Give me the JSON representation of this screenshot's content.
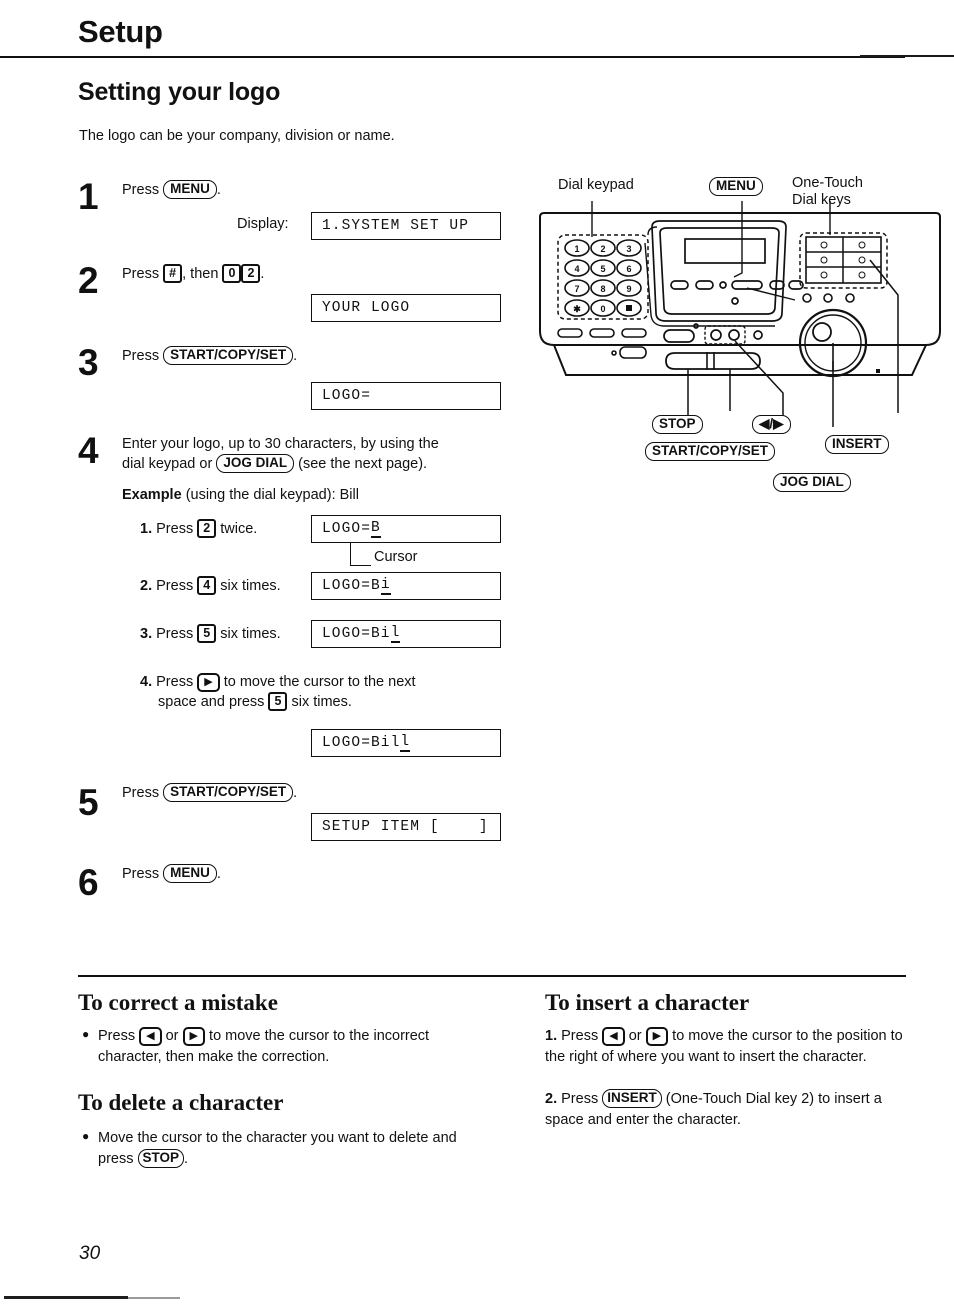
{
  "page": {
    "chapter": "Setup",
    "section_title": "Setting your logo",
    "intro": "The logo can be your company, division or name.",
    "page_number": "30"
  },
  "steps": [
    {
      "num": "1",
      "text_before": "Press",
      "key": "MENU",
      "text_after": ".",
      "display_label": "Display:",
      "lcd": "1.SYSTEM SET UP"
    },
    {
      "num": "2",
      "text_before": "Press",
      "key1": "#",
      "mid": ", then",
      "key2": "0",
      "key3": "2",
      "text_after": ".",
      "lcd": "YOUR LOGO"
    },
    {
      "num": "3",
      "text_before": "Press",
      "key": "START/COPY/SET",
      "text_after": ".",
      "lcd": "LOGO="
    },
    {
      "num": "4",
      "line1a": "Enter your logo, up to 30 characters, by using the",
      "line2a": "dial keypad or",
      "key": "JOG DIAL",
      "line2b": "(see the next page).",
      "example_bold": "Example",
      "example_rest": "(using the dial keypad):  Bill",
      "substeps": [
        {
          "n": "1.",
          "before": "Press",
          "key": "2",
          "after": "twice.",
          "lcd_prefix": "LOGO=",
          "lcd_cursor": "B",
          "lcd_suffix": "",
          "cursor_note": "Cursor"
        },
        {
          "n": "2.",
          "before": "Press",
          "key": "4",
          "after": "six times.",
          "lcd_prefix": "LOGO=B",
          "lcd_cursor": "i",
          "lcd_suffix": ""
        },
        {
          "n": "3.",
          "before": "Press",
          "key": "5",
          "after": "six times.",
          "lcd_prefix": "LOGO=Bi",
          "lcd_cursor": "l",
          "lcd_suffix": ""
        },
        {
          "n": "4.",
          "before": "Press",
          "key": "arrow-right",
          "after": "to move the cursor to the next",
          "line2_before": "space and press",
          "line2_key": "5",
          "line2_after": "six times.",
          "lcd_prefix": "LOGO=Bil",
          "lcd_cursor": "l",
          "lcd_suffix": ""
        }
      ]
    },
    {
      "num": "5",
      "text_before": "Press",
      "key": "START/COPY/SET",
      "text_after": ".",
      "lcd": "SETUP ITEM [    ]"
    },
    {
      "num": "6",
      "text_before": "Press",
      "key": "MENU",
      "text_after": "."
    }
  ],
  "diagram": {
    "labels": {
      "dial_keypad": "Dial keypad",
      "menu": "MENU",
      "one_touch_line1": "One-Touch",
      "one_touch_line2": "Dial keys"
    },
    "callouts": {
      "stop": "STOP",
      "arrows": "/",
      "start_copy_set": "START/COPY/SET",
      "insert": "INSERT",
      "jog_dial": "JOG DIAL"
    },
    "keypad_rows": [
      [
        "1",
        "2",
        "3"
      ],
      [
        "4",
        "5",
        "6"
      ],
      [
        "7",
        "8",
        "9"
      ],
      [
        "*",
        "0",
        "#"
      ]
    ]
  },
  "bottom": {
    "correct": {
      "heading": "To correct a mistake",
      "bullet": "●",
      "line1_before": "Press",
      "key_left": "arrow-left",
      "or": "or",
      "key_right": "arrow-right",
      "line1_after": "to move the cursor to the",
      "line2": "incorrect character, then make the correction."
    },
    "delete": {
      "heading": "To delete a character",
      "bullet": "●",
      "line1": "Move the cursor to the character you want to delete",
      "line2_before": "and press",
      "key": "STOP",
      "line2_after": "."
    },
    "insert": {
      "heading": "To insert a character",
      "item1_n": "1.",
      "item1_before": "Press",
      "key_left": "arrow-left",
      "or": "or",
      "key_right": "arrow-right",
      "item1_after": "to move the cursor to the",
      "item1_line2": "position to the right of where you want to",
      "item1_line3": "insert the character.",
      "item2_n": "2.",
      "item2_before": "Press",
      "item2_key": "INSERT",
      "item2_after": "(One-Touch Dial key 2) to",
      "item2_line2": "insert a space and enter the character."
    }
  }
}
